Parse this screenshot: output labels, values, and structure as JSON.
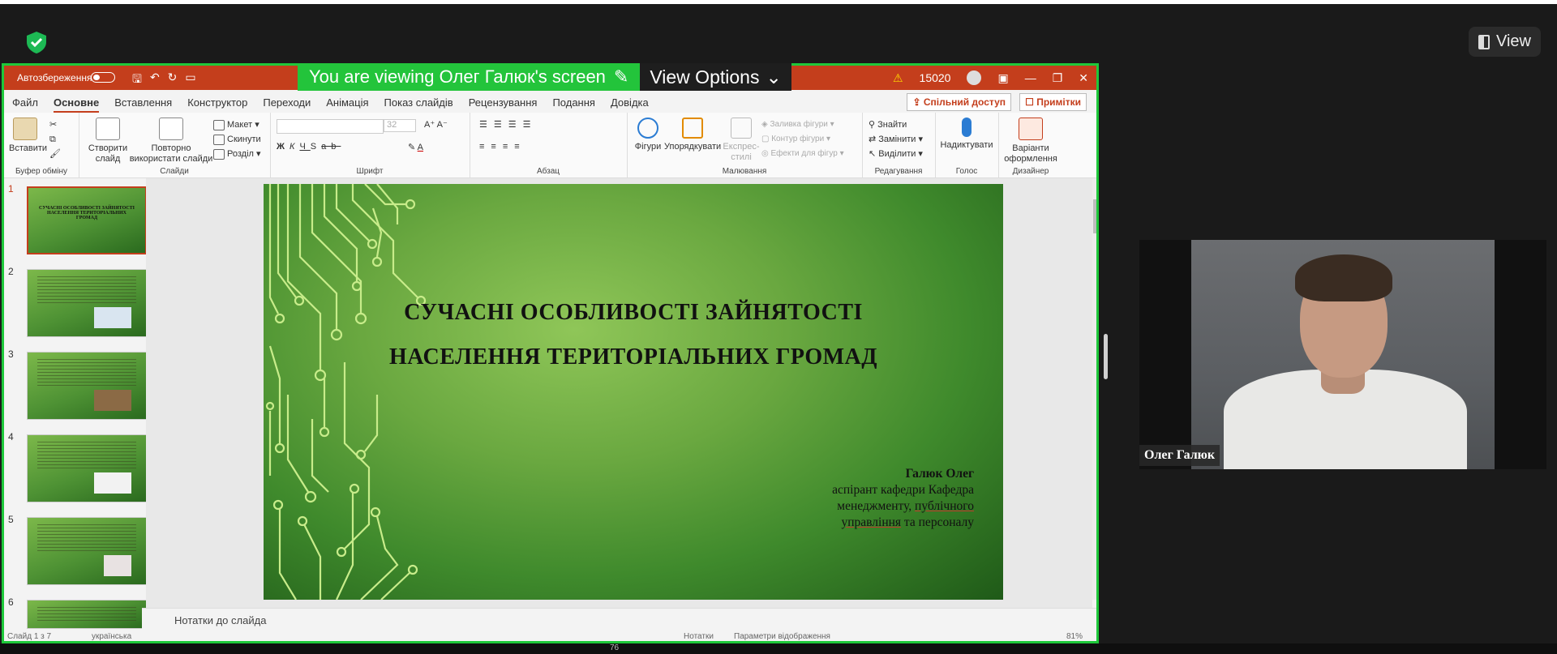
{
  "zoom_top": {
    "view_label": "View"
  },
  "banner": {
    "viewing_text": "You are viewing Олег Галюк's screen",
    "options_label": "View Options"
  },
  "ppt": {
    "autosave_label": "Автозбереження",
    "account_number": "15020",
    "menu_tabs": [
      "Файл",
      "Основне",
      "Вставлення",
      "Конструктор",
      "Переходи",
      "Анімація",
      "Показ слайдів",
      "Рецензування",
      "Подання",
      "Довідка"
    ],
    "share_label": "Спільний доступ",
    "notes_label": "Примітки",
    "ribbon": {
      "paste": "Вставити",
      "clipboard_group": "Буфер обміну",
      "new_slide": "Створити слайд",
      "reuse_slide": "Повторно використати слайди",
      "layout": "Макет",
      "reset": "Скинути",
      "section": "Розділ",
      "slides_group": "Слайди",
      "font_size": "32",
      "font_group": "Шрифт",
      "paragraph_group": "Абзац",
      "shapes": "Фігури",
      "arrange": "Упорядкувати",
      "express_styles": "Експрес-стилі",
      "shape_fill": "Заливка фігури",
      "shape_outline": "Контур фігури",
      "shape_effects": "Ефекти для фігур",
      "drawing_group": "Малювання",
      "find": "Знайти",
      "replace": "Замінити",
      "select": "Виділити",
      "editing_group": "Редагування",
      "dictate": "Надиктувати",
      "voice_group": "Голос",
      "design_ideas": "Варіанти оформлення",
      "designer_group": "Дизайнер"
    },
    "thumb_numbers": [
      "1",
      "2",
      "3",
      "4",
      "5",
      "6"
    ],
    "thumb1_title": "СУЧАСНІ ОСОБЛИВОСТІ ЗАЙНЯТОСТІ НАСЕЛЕННЯ ТЕРИТОРІАЛЬНИХ ГРОМАД",
    "slide": {
      "title_line1": "СУЧАСНІ ОСОБЛИВОСТІ ЗАЙНЯТОСТІ",
      "title_line2": "НАСЕЛЕННЯ ТЕРИТОРІАЛЬНИХ ГРОМАД",
      "author_name": "Галюк Олег",
      "author_line1": "аспірант кафедри Кафедра",
      "author_line2a": "менеджменту, ",
      "author_line2b": "публічного",
      "author_line3a": "управління",
      "author_line3b": " та персоналу"
    },
    "notes_placeholder": "Нотатки до слайда",
    "status_slide": "Слайд 1 з 7",
    "status_lang": "українська",
    "status_notes": "Нотатки",
    "status_display": "Параметри відображення",
    "status_zoom": "81%"
  },
  "video": {
    "participant_name": "Олег Галюк"
  },
  "taskbar": {
    "badge": "76"
  }
}
